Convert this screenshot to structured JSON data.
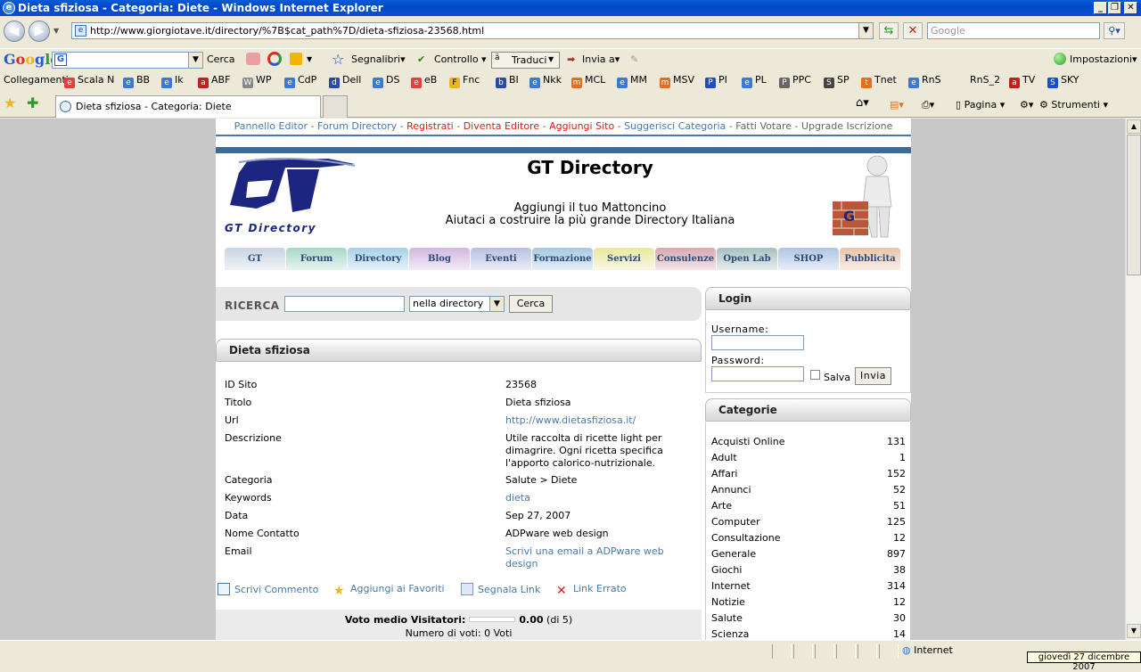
{
  "window": {
    "title": "Dieta sfiziosa - Categoria: Diete - Windows Internet Explorer"
  },
  "address": {
    "url": "http://www.giorgiotave.it/directory/%7B$cat_path%7D/dieta-sfiziosa-23568.html"
  },
  "search_box": {
    "placeholder": "Google"
  },
  "google_toolbar": {
    "logo": "Google",
    "cerca": "Cerca",
    "segnalibri": "Segnalibri",
    "controllo": "Controllo",
    "traduci": "Traduci",
    "invia": "Invia a",
    "impostazioni": "Impostazioni"
  },
  "links_bar": {
    "label": "Collegamenti",
    "items": [
      "Scala N",
      "BB",
      "Ik",
      "ABF",
      "WP",
      "CdP",
      "Dell",
      "DS",
      "eB",
      "Fnc",
      "BI",
      "Nkk",
      "MCL",
      "MM",
      "MSV",
      "PI",
      "PL",
      "PPC",
      "SP",
      "Tnet",
      "RnS",
      "RnS_2",
      "TV",
      "SKY"
    ]
  },
  "tab": {
    "label": "Dieta sfiziosa - Categoria: Diete"
  },
  "command_bar": {
    "pagina": "Pagina",
    "strumenti": "Strumenti"
  },
  "site": {
    "top_links": {
      "pannello": "Pannello Editor",
      "forum": "Forum Directory",
      "registrati": "Registrati",
      "diventa": "Diventa Editore",
      "aggiungi": "Aggiungi Sito",
      "suggerisci": "Suggerisci Categoria",
      "fatti": "Fatti Votare",
      "upgrade": "Upgrade Iscrizione"
    },
    "logo_text": "GT Directory",
    "title": "GT Directory",
    "tagline1": "Aggiungi il tuo Mattoncino",
    "tagline2": "Aiutaci a costruire la più grande Directory Italiana",
    "menu": [
      {
        "label": "GT",
        "color": "#c8d4e2"
      },
      {
        "label": "Forum",
        "color": "#a8d8c8"
      },
      {
        "label": "Directory",
        "color": "#a8d0e8"
      },
      {
        "label": "Blog",
        "color": "#d0b8e0"
      },
      {
        "label": "Eventi",
        "color": "#b8c0e0"
      },
      {
        "label": "Formazione",
        "color": "#a8c8e0"
      },
      {
        "label": "Servizi",
        "color": "#e8e8a0"
      },
      {
        "label": "Consulenze",
        "color": "#d8a8b0"
      },
      {
        "label": "Open Lab",
        "color": "#a8c0c0"
      },
      {
        "label": "SHOP",
        "color": "#b0c4e4"
      },
      {
        "label": "Pubblicita",
        "color": "#e8c4a8"
      }
    ],
    "search": {
      "label": "RICERCA",
      "scope": "nella directory",
      "button": "Cerca"
    },
    "detail": {
      "heading": "Dieta sfiziosa",
      "rows": [
        {
          "key": "ID Sito",
          "value": "23568"
        },
        {
          "key": "Titolo",
          "value": "Dieta sfiziosa"
        },
        {
          "key": "Url",
          "value": "http://www.dietasfiziosa.it/"
        },
        {
          "key": "Descrizione",
          "value": "Utile raccolta di ricette light per dimagrire. Ogni ricetta specifica l'apporto calorico-nutrizionale."
        },
        {
          "key": "Categoria",
          "value": "Salute > Diete"
        },
        {
          "key": "Keywords",
          "value": "dieta"
        },
        {
          "key": "Data",
          "value": "Sep 27, 2007"
        },
        {
          "key": "Nome Contatto",
          "value": "ADPware web design"
        },
        {
          "key": "Email",
          "value": "Scrivi una email a ADPware web design"
        }
      ],
      "actions": {
        "commento": "Scrivi Commento",
        "favoriti": "Aggiungi ai Favoriti",
        "segnala": "Segnala Link",
        "errato": "Link Errato"
      },
      "vote": {
        "label": "Voto medio Visitatori:",
        "value": "0.00",
        "of": "(di 5)",
        "count": "Numero di voti: 0 Voti"
      }
    },
    "login": {
      "heading": "Login",
      "username": "Username:",
      "password": "Password:",
      "salva": "Salva",
      "button": "Invia"
    },
    "categories": {
      "heading": "Categorie",
      "items": [
        {
          "name": "Acquisti Online",
          "count": "131"
        },
        {
          "name": "Adult",
          "count": "1"
        },
        {
          "name": "Affari",
          "count": "152"
        },
        {
          "name": "Annunci",
          "count": "52"
        },
        {
          "name": "Arte",
          "count": "51"
        },
        {
          "name": "Computer",
          "count": "125"
        },
        {
          "name": "Consultazione",
          "count": "12"
        },
        {
          "name": "Generale",
          "count": "897"
        },
        {
          "name": "Giochi",
          "count": "38"
        },
        {
          "name": "Internet",
          "count": "314"
        },
        {
          "name": "Notizie",
          "count": "12"
        },
        {
          "name": "Salute",
          "count": "30"
        },
        {
          "name": "Scienza",
          "count": "14"
        }
      ]
    }
  },
  "status": {
    "zone": "Internet",
    "clock": "giovedì 27 dicembre 2007"
  }
}
